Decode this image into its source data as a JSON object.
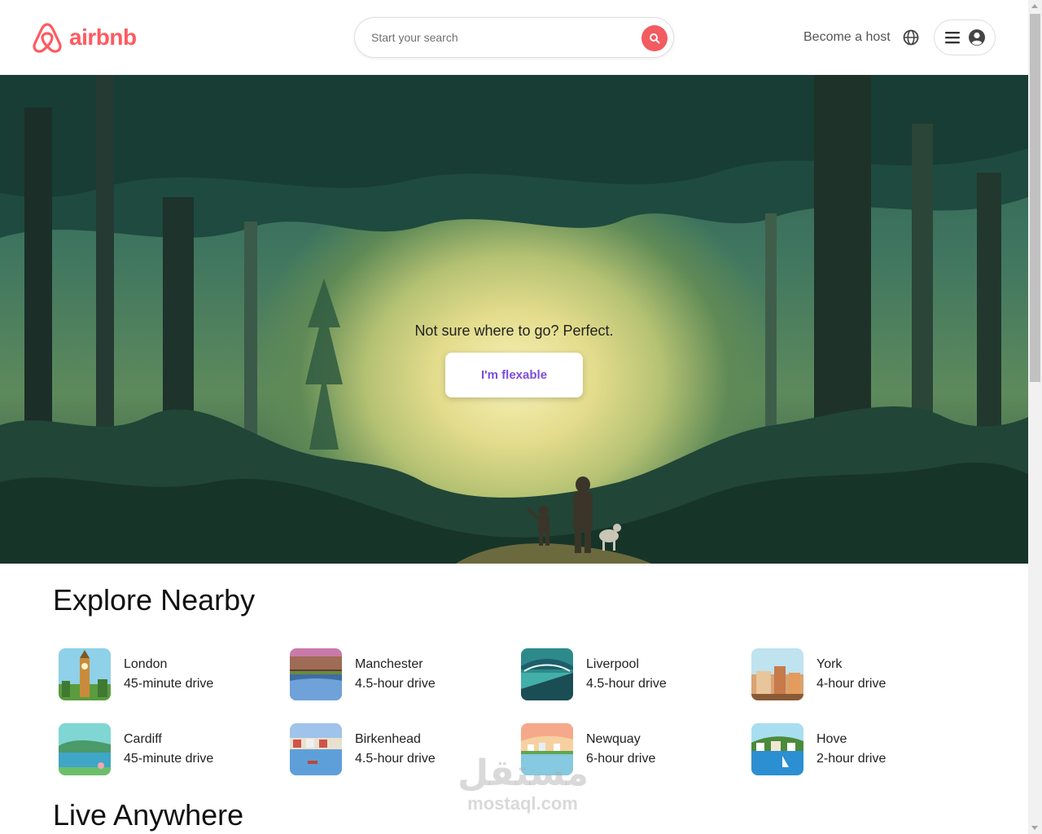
{
  "header": {
    "brand": "airbnb",
    "search_placeholder": "Start your search",
    "host_link": "Become a host",
    "globe_icon": "globe-icon",
    "menu_icon": "hamburger-icon",
    "avatar_icon": "user-avatar-icon",
    "brand_color": "#ff5a5f"
  },
  "hero": {
    "tagline": "Not sure where to go? Perfect.",
    "button_label": "I'm flexable",
    "button_color": "#7c4ddb"
  },
  "explore": {
    "title": "Explore Nearby",
    "items": [
      {
        "city": "London",
        "distance": "45-minute drive"
      },
      {
        "city": "Manchester",
        "distance": "4.5-hour drive"
      },
      {
        "city": "Liverpool",
        "distance": "4.5-hour drive"
      },
      {
        "city": "York",
        "distance": "4-hour drive"
      },
      {
        "city": "Cardiff",
        "distance": "45-minute drive"
      },
      {
        "city": "Birkenhead",
        "distance": "4.5-hour drive"
      },
      {
        "city": "Newquay",
        "distance": "6-hour drive"
      },
      {
        "city": "Hove",
        "distance": "2-hour drive"
      }
    ]
  },
  "live": {
    "title": "Live Anywhere"
  },
  "watermark": {
    "arabic": "مستقل",
    "latin": "mostaql.com"
  }
}
